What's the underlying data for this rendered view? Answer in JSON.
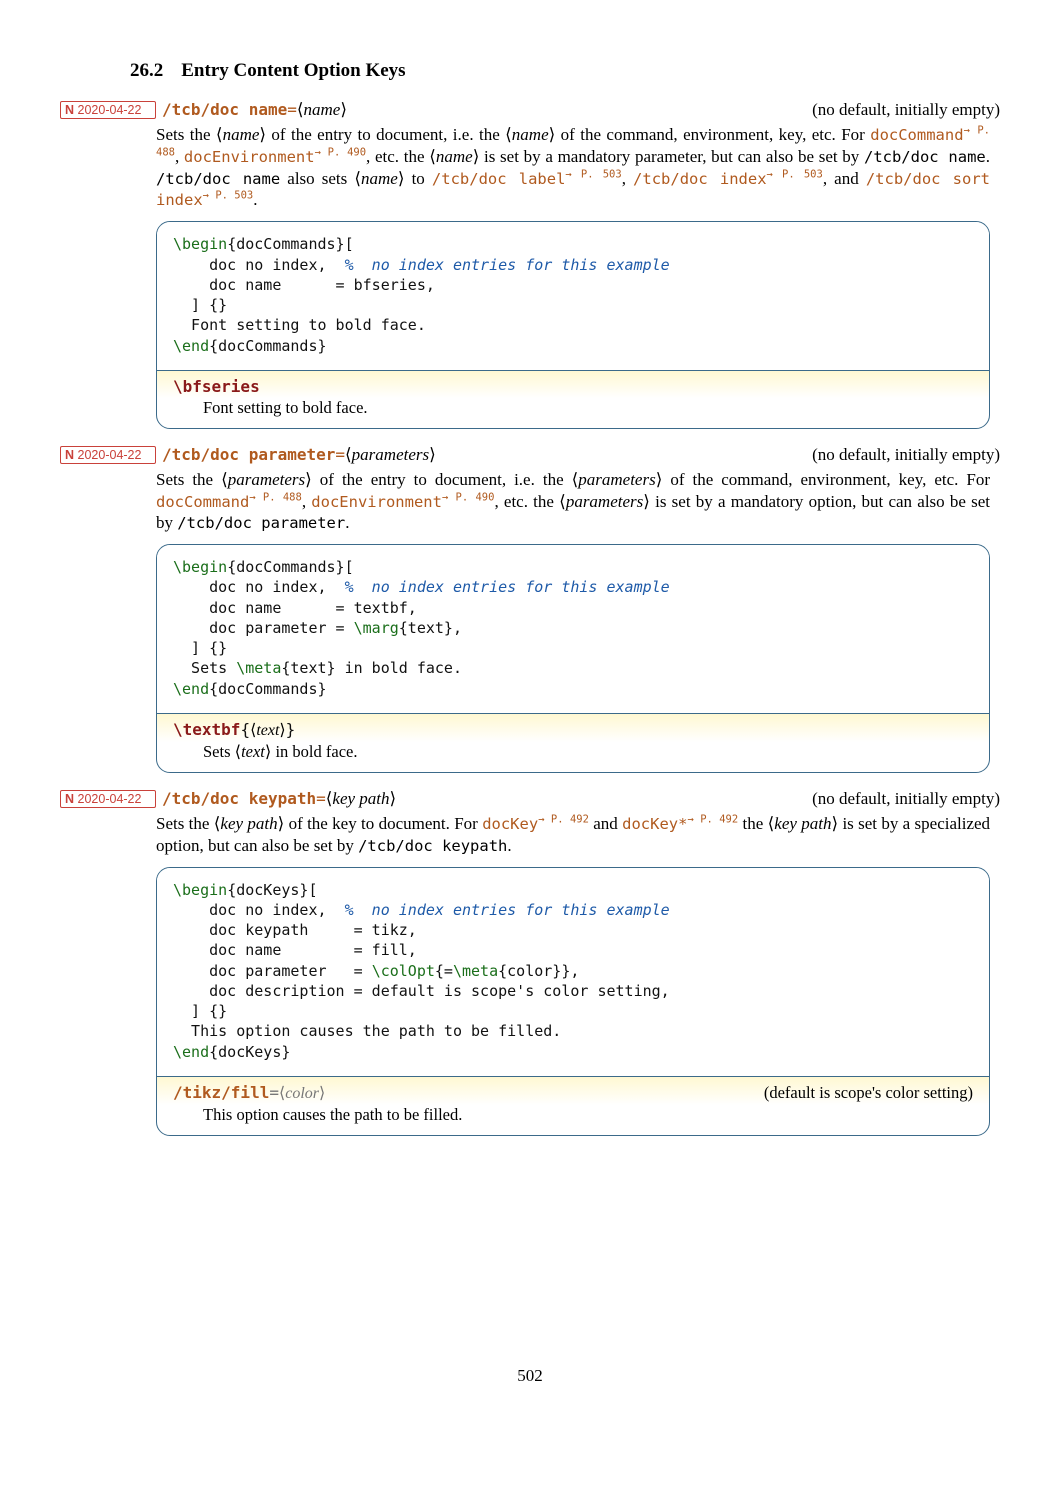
{
  "section": {
    "number": "26.2",
    "title": "Entry Content Option Keys"
  },
  "badges": {
    "b1": "2020-04-22",
    "b2": "2020-04-22",
    "b3": "2020-04-22",
    "prefix": "N"
  },
  "entries": {
    "docname": {
      "key": "/tcb/doc name",
      "arg": "name",
      "def": "(no default, initially empty)",
      "result_cmd": "\\bfseries",
      "result_desc": "Font setting to bold face."
    },
    "docparam": {
      "key": "/tcb/doc parameter",
      "arg": "parameters",
      "def": "(no default, initially empty)",
      "result_cmd": "\\textbf",
      "result_arg": "text",
      "result_desc_pre": "Sets ",
      "result_desc_post": " in bold face."
    },
    "dockeypath": {
      "key": "/tcb/doc keypath",
      "arg": "key path",
      "def": "(no default, initially empty)",
      "result_key": "/tikz/fill",
      "result_arg": "color",
      "result_side": "(default is scope's color setting)",
      "result_desc": "This option causes the path to be filled."
    }
  },
  "links": {
    "docCommand": "docCommand",
    "docCommand_ref": "→ P. 488",
    "docEnvironment": "docEnvironment",
    "docEnvironment_ref": "→ P. 490",
    "docKey": "docKey",
    "docKey_ref": "→ P. 492",
    "docKeyStar": "docKey*",
    "docKeyStar_ref": "→ P. 492",
    "tcbDocLabel": "/tcb/doc label",
    "tcbDocIndex": "/tcb/doc index",
    "tcbDocSortIndex": "/tcb/doc sort index",
    "p503": "→ P. 503",
    "tcbDocName_plain": "/tcb/doc name",
    "tcbDocParam_plain": "/tcb/doc parameter",
    "tcbDocKeypath_plain": "/tcb/doc keypath"
  },
  "code": {
    "c1_l1": "\\begin",
    "c1_l1b": "{docCommands}[",
    "c1_l2a": "    doc no index,  ",
    "c1_l2b": "%  no index entries for this example",
    "c1_l3": "    doc name      = bfseries,",
    "c1_l4": "  ] {}",
    "c1_l5": "  Font setting to bold face.",
    "c1_l6a": "\\end",
    "c1_l6b": "{docCommands}",
    "c2_l1a": "\\begin",
    "c2_l1b": "{docCommands}[",
    "c2_l2a": "    doc no index,  ",
    "c2_l2b": "%  no index entries for this example",
    "c2_l3": "    doc name      = textbf,",
    "c2_l4a": "    doc parameter = ",
    "c2_l4b": "\\marg",
    "c2_l4c": "{text},",
    "c2_l5": "  ] {}",
    "c2_l6a": "  Sets ",
    "c2_l6b": "\\meta",
    "c2_l6c": "{text} in bold face.",
    "c2_l7a": "\\end",
    "c2_l7b": "{docCommands}",
    "c3_l1a": "\\begin",
    "c3_l1b": "{docKeys}[",
    "c3_l2a": "    doc no index,  ",
    "c3_l2b": "%  no index entries for this example",
    "c3_l3": "    doc keypath     = tikz,",
    "c3_l4": "    doc name        = fill,",
    "c3_l5a": "    doc parameter   = ",
    "c3_l5b": "\\colOpt",
    "c3_l5c": "{=",
    "c3_l5d": "\\meta",
    "c3_l5e": "{color}},",
    "c3_l6": "    doc description = default is scope's color setting,",
    "c3_l7": "  ] {}",
    "c3_l8": "  This option causes the path to be filled.",
    "c3_l9a": "\\end",
    "c3_l9b": "{docKeys}"
  },
  "pageNumber": "502"
}
